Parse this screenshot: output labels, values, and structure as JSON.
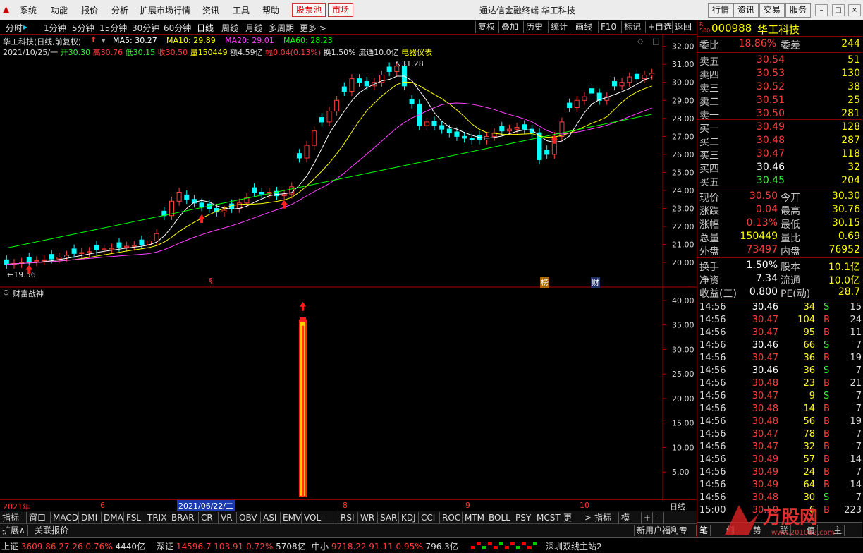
{
  "menu": {
    "items": [
      "系统",
      "功能",
      "报价",
      "分析",
      "扩展市场行情",
      "资讯",
      "工具",
      "帮助"
    ],
    "red_items": [
      "股票池",
      "市场"
    ],
    "title": "通达信金融终端  华工科技",
    "right_buttons": [
      "行情",
      "资讯",
      "交易",
      "服务"
    ]
  },
  "periods": [
    "分时",
    "1分钟",
    "5分钟",
    "15分钟",
    "30分钟",
    "60分钟",
    "日线",
    "周线",
    "月线",
    "多周期",
    "更多 >"
  ],
  "active_period": "日线",
  "tools": [
    "复权",
    "叠加",
    "历史",
    "统计",
    "画线",
    "F10",
    "标记",
    "+自选",
    "返回"
  ],
  "main_chart": {
    "stock_title": "华工科技(日线,前复权)",
    "ma": [
      {
        "label": "MA5: 30.27",
        "color": "#ffffff"
      },
      {
        "label": "MA10: 29.89",
        "color": "#ffff00"
      },
      {
        "label": "MA20: 29.01",
        "color": "#ff40ff"
      },
      {
        "label": "MA60: 28.23",
        "color": "#00ff00"
      }
    ],
    "info_line": [
      {
        "text": "2021/10/25/一 ",
        "color": "#dddddd"
      },
      {
        "text": "开30.30 ",
        "color": "#3cf03c"
      },
      {
        "text": "高30.76 ",
        "color": "#ff3c3c"
      },
      {
        "text": "低30.15 ",
        "color": "#3cf03c"
      },
      {
        "text": "收30.50 ",
        "color": "#ff3c3c"
      },
      {
        "text": "量150449 ",
        "color": "#ffff00"
      },
      {
        "text": "额4.59亿 ",
        "color": "#dddddd"
      },
      {
        "text": "幅0.04(0.13%) ",
        "color": "#ff3c3c"
      },
      {
        "text": "换1.50% 流通10.0亿 ",
        "color": "#dddddd"
      },
      {
        "text": "电器仪表",
        "color": "#ffff00"
      }
    ],
    "high_label": "31.28",
    "low_label": "19.56",
    "markers": [
      "§",
      "榜",
      "财"
    ]
  },
  "chart_data": [
    {
      "type": "candlestick",
      "title": "华工科技(日线,前复权)",
      "y_ticks": [
        20.0,
        21.0,
        22.0,
        23.0,
        24.0,
        25.0,
        26.0,
        27.0,
        28.0,
        29.0,
        30.0,
        31.0,
        32.0
      ],
      "ylim": [
        19.3,
        32.3
      ],
      "x_ticks": [
        "2021年",
        "6",
        "2021/06/22/二",
        "8",
        "9",
        "10"
      ],
      "closes": [
        19.9,
        19.95,
        20.0,
        20.05,
        20.1,
        20.15,
        20.2,
        20.3,
        20.4,
        20.5,
        20.55,
        20.6,
        20.7,
        20.75,
        20.8,
        20.85,
        20.9,
        20.95,
        21.0,
        21.2,
        21.6,
        22.6,
        23.4,
        23.9,
        23.5,
        23.3,
        23.1,
        23.0,
        22.8,
        22.9,
        23.0,
        23.3,
        23.6,
        23.9,
        23.8,
        23.9,
        23.7,
        23.8,
        24.2,
        25.8,
        26.5,
        27.3,
        27.8,
        28.4,
        29.0,
        29.5,
        30.2,
        30.0,
        29.8,
        30.0,
        30.4,
        30.6,
        30.9,
        29.8,
        28.8,
        27.6,
        27.8,
        27.6,
        27.4,
        27.2,
        27.0,
        26.9,
        26.8,
        26.8,
        27.0,
        27.2,
        27.3,
        27.4,
        27.5,
        27.4,
        27.2,
        25.7,
        26.0,
        27.0,
        27.8,
        28.6,
        29.0,
        29.2,
        29.4,
        29.0,
        29.2,
        29.8,
        30.0,
        30.3,
        30.2,
        30.4,
        30.5
      ],
      "ma60_end": 28.23,
      "ma20_end": 29.01,
      "ma10_end": 29.89,
      "ma5_end": 30.27
    },
    {
      "type": "bar",
      "title": "财富战神",
      "y_ticks": [
        5.0,
        10.0,
        15.0,
        20.0,
        25.0,
        30.0,
        35.0,
        40.0
      ],
      "ylim": [
        0,
        42
      ],
      "spike_value": 36.0
    }
  ],
  "indicator": {
    "name": "财富战神"
  },
  "date_axis": [
    "2021年",
    "6",
    "2021/06/22/二",
    "8",
    "9",
    "10",
    "日线"
  ],
  "tabs": [
    "指标A",
    "窗口",
    "MACD",
    "DMI",
    "DMA",
    "FSL",
    "TRIX",
    "BRAR",
    "CR",
    "VR",
    "OBV",
    "ASI",
    "EMV",
    "VOL-TDX",
    "RSI",
    "WR",
    "SAR",
    "KDJ",
    "CCI",
    "ROC",
    "MTM",
    "BOLL",
    "PSY",
    "MCST",
    "更多",
    ">",
    "指标B",
    "模 板",
    "+",
    "-"
  ],
  "tabs2": [
    "扩展∧",
    "关联报价"
  ],
  "promo": "新用户福利专享",
  "panel": {
    "code": "000988",
    "name": "华工科技",
    "r_label": "R",
    "r_sub": "500",
    "ratio_label": "委比",
    "ratio": "18.86%",
    "diff_label": "委差",
    "diff": "244",
    "sells": [
      {
        "label": "卖五",
        "price": "30.54",
        "vol": "51"
      },
      {
        "label": "卖四",
        "price": "30.53",
        "vol": "130"
      },
      {
        "label": "卖三",
        "price": "30.52",
        "vol": "38"
      },
      {
        "label": "卖二",
        "price": "30.51",
        "vol": "25"
      },
      {
        "label": "卖一",
        "price": "30.50",
        "vol": "281"
      }
    ],
    "buys": [
      {
        "label": "买一",
        "price": "30.49",
        "vol": "128"
      },
      {
        "label": "买二",
        "price": "30.48",
        "vol": "287"
      },
      {
        "label": "买三",
        "price": "30.47",
        "vol": "118"
      },
      {
        "label": "买四",
        "price": "30.46",
        "vol": "32"
      },
      {
        "label": "买五",
        "price": "30.45",
        "vol": "204"
      }
    ],
    "quote": [
      {
        "l1": "现价",
        "v1": "30.50",
        "c1": "red",
        "l2": "今开",
        "v2": "30.30",
        "c2": "grn"
      },
      {
        "l1": "涨跌",
        "v1": "0.04",
        "c1": "red",
        "l2": "最高",
        "v2": "30.76",
        "c2": "red"
      },
      {
        "l1": "涨幅",
        "v1": "0.13%",
        "c1": "red",
        "l2": "最低",
        "v2": "30.15",
        "c2": "grn"
      },
      {
        "l1": "总量",
        "v1": "150449",
        "c1": "yel",
        "l2": "量比",
        "v2": "0.69",
        "c2": "yel"
      },
      {
        "l1": "外盘",
        "v1": "73497",
        "c1": "red",
        "l2": "内盘",
        "v2": "76952",
        "c2": "grn"
      }
    ],
    "fund": [
      {
        "l1": "换手",
        "v1": "1.50%",
        "l2": "股本",
        "v2": "10.1亿"
      },
      {
        "l1": "净资",
        "v1": "7.34",
        "l2": "流通",
        "v2": "10.0亿"
      },
      {
        "l1": "收益(三)",
        "v1": "0.800",
        "l2": "PE(动)",
        "v2": "28.7"
      }
    ],
    "ticks": [
      {
        "t": "14:56",
        "p": "30.46",
        "pc": "wht",
        "v": "34",
        "s": "S",
        "n": "15"
      },
      {
        "t": "14:56",
        "p": "30.47",
        "pc": "red",
        "v": "104",
        "s": "B",
        "n": "24"
      },
      {
        "t": "14:56",
        "p": "30.47",
        "pc": "red",
        "v": "95",
        "s": "B",
        "n": "11"
      },
      {
        "t": "14:56",
        "p": "30.46",
        "pc": "wht",
        "v": "66",
        "s": "S",
        "n": "7"
      },
      {
        "t": "14:56",
        "p": "30.47",
        "pc": "red",
        "v": "36",
        "s": "B",
        "n": "19"
      },
      {
        "t": "14:56",
        "p": "30.46",
        "pc": "wht",
        "v": "36",
        "s": "S",
        "n": "7"
      },
      {
        "t": "14:56",
        "p": "30.48",
        "pc": "red",
        "v": "23",
        "s": "B",
        "n": "21"
      },
      {
        "t": "14:56",
        "p": "30.47",
        "pc": "red",
        "v": "9",
        "s": "S",
        "n": "7"
      },
      {
        "t": "14:56",
        "p": "30.48",
        "pc": "red",
        "v": "14",
        "s": "B",
        "n": "7"
      },
      {
        "t": "14:56",
        "p": "30.48",
        "pc": "red",
        "v": "56",
        "s": "B",
        "n": "19"
      },
      {
        "t": "14:56",
        "p": "30.47",
        "pc": "red",
        "v": "78",
        "s": "B",
        "n": "7"
      },
      {
        "t": "14:56",
        "p": "30.47",
        "pc": "red",
        "v": "32",
        "s": "B",
        "n": "7"
      },
      {
        "t": "14:56",
        "p": "30.49",
        "pc": "red",
        "v": "57",
        "s": "B",
        "n": "14"
      },
      {
        "t": "14:56",
        "p": "30.49",
        "pc": "red",
        "v": "24",
        "s": "B",
        "n": "7"
      },
      {
        "t": "14:56",
        "p": "30.49",
        "pc": "red",
        "v": "64",
        "s": "B",
        "n": "14"
      },
      {
        "t": "14:56",
        "p": "30.48",
        "pc": "red",
        "v": "30",
        "s": "S",
        "n": "7"
      },
      {
        "t": "15:00",
        "p": "30.50",
        "pc": "red",
        "v": "6",
        "s": "B",
        "n": "223"
      }
    ],
    "bottom_tabs": [
      "笔",
      "细",
      "势",
      "联",
      "值",
      "主"
    ]
  },
  "status": [
    {
      "label": "上证",
      "v": "3609.86",
      "c": "27.26",
      "p": "0.76%",
      "amt": "4440亿"
    },
    {
      "label": "深证",
      "v": "14596.7",
      "c": "103.91",
      "p": "0.72%",
      "amt": "5708亿"
    },
    {
      "label": "中小",
      "v": "9718.22",
      "c": "91.11",
      "p": "0.95%",
      "amt": "796.3亿"
    }
  ],
  "server": "深圳双线主站2",
  "watermark": {
    "logo": "万股网",
    "url": "www.201082.com"
  }
}
